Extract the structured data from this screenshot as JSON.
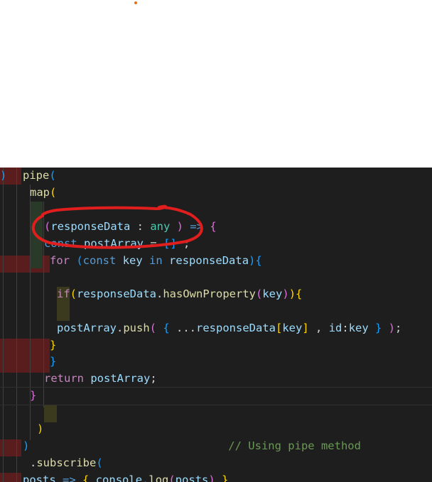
{
  "editor": {
    "language": "typescript",
    "theme_colors": {
      "background": "#1e1e1e",
      "keyword": "#569cd6",
      "control": "#c586c0",
      "variable": "#9cdcfe",
      "function": "#dcdcaa",
      "type": "#4ec9b0",
      "comment": "#6a9955",
      "annotation_circle": "#e01e1e"
    },
    "lines": [
      {
        "tokens": [
          {
            "t": "pipe",
            "c": "fn"
          },
          {
            "t": "(",
            "c": "b3"
          }
        ]
      },
      {
        "tokens": [
          {
            "t": "map",
            "c": "fn"
          },
          {
            "t": "(",
            "c": "b1"
          }
        ]
      },
      {
        "tokens": []
      },
      {
        "tokens": [
          {
            "t": "(",
            "c": "b2"
          },
          {
            "t": "responseData",
            "c": "var"
          },
          {
            "t": " : ",
            "c": "txt"
          },
          {
            "t": "any",
            "c": "ty"
          },
          {
            "t": " ) ",
            "c": "b2"
          },
          {
            "t": "=>",
            "c": "kw"
          },
          {
            "t": " {",
            "c": "b2"
          }
        ]
      },
      {
        "tokens": [
          {
            "t": "const",
            "c": "kw"
          },
          {
            "t": " ",
            "c": "txt"
          },
          {
            "t": "postArray",
            "c": "var"
          },
          {
            "t": " = ",
            "c": "txt"
          },
          {
            "t": "[]",
            "c": "b3"
          },
          {
            "t": " ;",
            "c": "txt"
          }
        ]
      },
      {
        "tokens": [
          {
            "t": "for",
            "c": "ctl"
          },
          {
            "t": " (",
            "c": "b3"
          },
          {
            "t": "const",
            "c": "kw"
          },
          {
            "t": " ",
            "c": "txt"
          },
          {
            "t": "key",
            "c": "var"
          },
          {
            "t": " ",
            "c": "txt"
          },
          {
            "t": "in",
            "c": "kw"
          },
          {
            "t": " ",
            "c": "txt"
          },
          {
            "t": "responseData",
            "c": "var"
          },
          {
            "t": ")",
            "c": "b3"
          },
          {
            "t": "{",
            "c": "b3"
          }
        ]
      },
      {
        "tokens": []
      },
      {
        "tokens": [
          {
            "t": "if",
            "c": "ctl"
          },
          {
            "t": "(",
            "c": "b1"
          },
          {
            "t": "responseData",
            "c": "var"
          },
          {
            "t": ".",
            "c": "txt"
          },
          {
            "t": "hasOwnProperty",
            "c": "fn"
          },
          {
            "t": "(",
            "c": "b2"
          },
          {
            "t": "key",
            "c": "var"
          },
          {
            "t": ")",
            "c": "b2"
          },
          {
            "t": ")",
            "c": "b1"
          },
          {
            "t": "{",
            "c": "b1"
          }
        ]
      },
      {
        "tokens": []
      },
      {
        "tokens": [
          {
            "t": "postArray",
            "c": "var"
          },
          {
            "t": ".",
            "c": "txt"
          },
          {
            "t": "push",
            "c": "fn"
          },
          {
            "t": "( ",
            "c": "b2"
          },
          {
            "t": "{",
            "c": "b3"
          },
          {
            "t": " ...",
            "c": "txt"
          },
          {
            "t": "responseData",
            "c": "var"
          },
          {
            "t": "[",
            "c": "b1"
          },
          {
            "t": "key",
            "c": "var"
          },
          {
            "t": "]",
            "c": "b1"
          },
          {
            "t": " , ",
            "c": "txt"
          },
          {
            "t": "id",
            "c": "var"
          },
          {
            "t": ":",
            "c": "txt"
          },
          {
            "t": "key",
            "c": "var"
          },
          {
            "t": " }",
            "c": "b3"
          },
          {
            "t": " )",
            "c": "b2"
          },
          {
            "t": ";",
            "c": "txt"
          }
        ]
      },
      {
        "tokens": [
          {
            "t": "}",
            "c": "b1"
          }
        ]
      },
      {
        "tokens": [
          {
            "t": "}",
            "c": "b3"
          }
        ]
      },
      {
        "tokens": [
          {
            "t": "return",
            "c": "ctl"
          },
          {
            "t": " ",
            "c": "txt"
          },
          {
            "t": "postArray",
            "c": "var"
          },
          {
            "t": ";",
            "c": "txt"
          }
        ]
      },
      {
        "tokens": [
          {
            "t": "}",
            "c": "b2"
          }
        ]
      },
      {
        "tokens": []
      },
      {
        "tokens": [
          {
            "t": ")",
            "c": "b1"
          }
        ]
      },
      {
        "tokens": [
          {
            "t": ")",
            "c": "b3"
          },
          {
            "t": "                              // Using pipe method",
            "c": "cm"
          }
        ]
      },
      {
        "tokens": [
          {
            "t": ".",
            "c": "txt"
          },
          {
            "t": "subscribe",
            "c": "fn"
          },
          {
            "t": "(",
            "c": "b3"
          }
        ]
      },
      {
        "tokens": [
          {
            "t": "posts",
            "c": "var"
          },
          {
            "t": " ",
            "c": "txt"
          },
          {
            "t": "=>",
            "c": "kw"
          },
          {
            "t": " ",
            "c": "txt"
          },
          {
            "t": "{",
            "c": "b1"
          },
          {
            "t": " ",
            "c": "txt"
          },
          {
            "t": "console",
            "c": "var"
          },
          {
            "t": ".",
            "c": "txt"
          },
          {
            "t": "log",
            "c": "fn"
          },
          {
            "t": "(",
            "c": "b2"
          },
          {
            "t": "posts",
            "c": "var"
          },
          {
            "t": ")",
            "c": "b2"
          },
          {
            "t": " }",
            "c": "b1"
          }
        ]
      },
      {
        "tokens": [
          {
            "t": ")",
            "c": "b3"
          }
        ]
      }
    ]
  }
}
